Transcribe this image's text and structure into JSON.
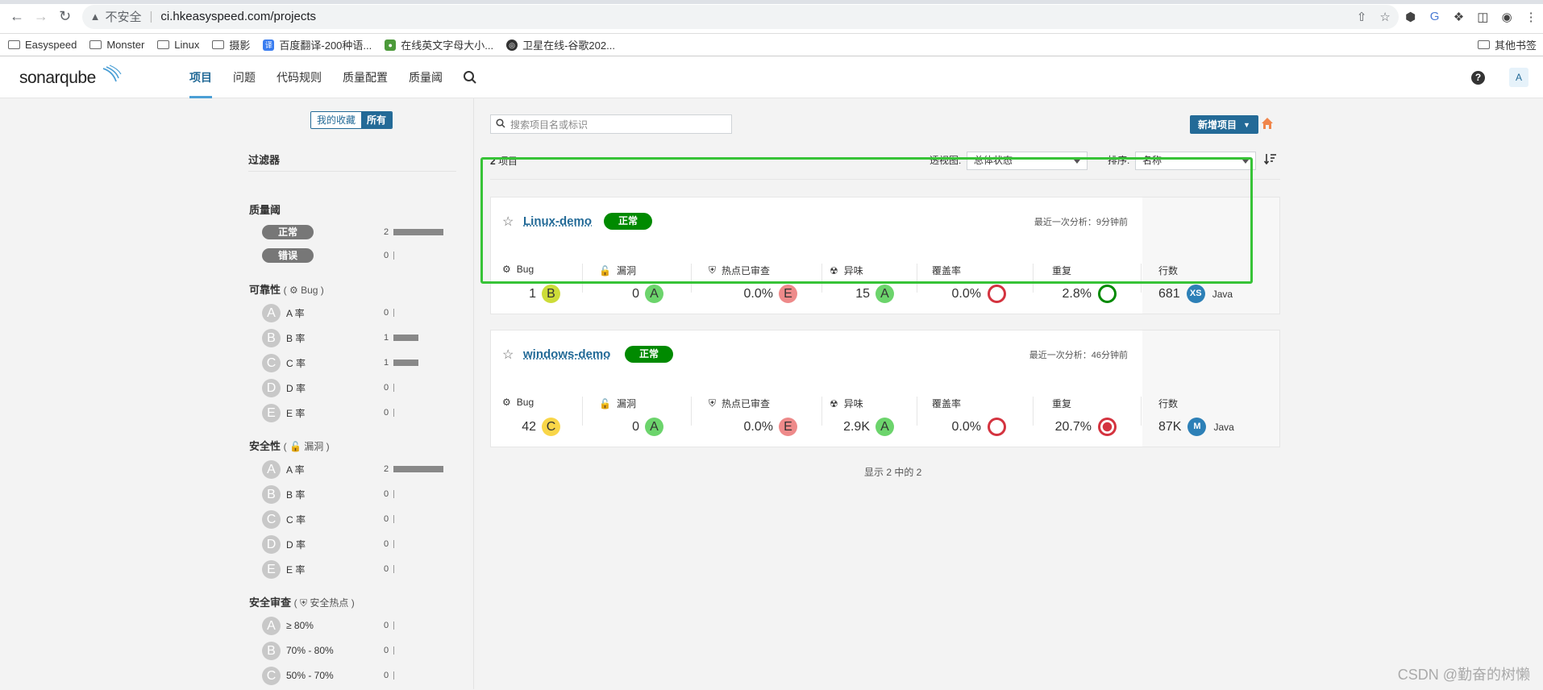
{
  "browser": {
    "insecure_label": "不安全",
    "url": "ci.hkeasyspeed.com/projects",
    "bookmarks": [
      {
        "label": "Easyspeed"
      },
      {
        "label": "Monster"
      },
      {
        "label": "Linux"
      },
      {
        "label": "摄影"
      },
      {
        "label": "百度翻译-200种语..."
      },
      {
        "label": "在线英文字母大小..."
      },
      {
        "label": "卫星在线-谷歌202..."
      }
    ],
    "other_bookmarks": "其他书签"
  },
  "header": {
    "logo": "sonarqube",
    "nav": [
      "项目",
      "问题",
      "代码规则",
      "质量配置",
      "质量阈"
    ],
    "avatar": "A",
    "help": "?"
  },
  "sidebar": {
    "toggle": {
      "favorites": "我的收藏",
      "all": "所有"
    },
    "filter_title": "过滤器",
    "quality_gate": {
      "title": "质量阈",
      "rows": [
        {
          "label": "正常",
          "count": "2",
          "ratio": 1.0
        },
        {
          "label": "错误",
          "count": "0",
          "ratio": 0
        }
      ]
    },
    "reliability": {
      "title": "可靠性",
      "sub": "Bug",
      "rows": [
        {
          "letter": "A",
          "label": "A 率",
          "count": "0",
          "ratio": 0
        },
        {
          "letter": "B",
          "label": "B 率",
          "count": "1",
          "ratio": 0.5
        },
        {
          "letter": "C",
          "label": "C 率",
          "count": "1",
          "ratio": 0.5
        },
        {
          "letter": "D",
          "label": "D 率",
          "count": "0",
          "ratio": 0
        },
        {
          "letter": "E",
          "label": "E 率",
          "count": "0",
          "ratio": 0
        }
      ]
    },
    "security": {
      "title": "安全性",
      "sub": "漏洞",
      "rows": [
        {
          "letter": "A",
          "label": "A 率",
          "count": "2",
          "ratio": 1.0
        },
        {
          "letter": "B",
          "label": "B 率",
          "count": "0",
          "ratio": 0
        },
        {
          "letter": "C",
          "label": "C 率",
          "count": "0",
          "ratio": 0
        },
        {
          "letter": "D",
          "label": "D 率",
          "count": "0",
          "ratio": 0
        },
        {
          "letter": "E",
          "label": "E 率",
          "count": "0",
          "ratio": 0
        }
      ]
    },
    "hotspots": {
      "title": "安全审查",
      "sub": "安全热点",
      "rows": [
        {
          "letter": "A",
          "label": "≥ 80%",
          "count": "0",
          "ratio": 0
        },
        {
          "letter": "B",
          "label": "70% - 80%",
          "count": "0",
          "ratio": 0
        },
        {
          "letter": "C",
          "label": "50% - 70%",
          "count": "0",
          "ratio": 0
        }
      ]
    }
  },
  "toolbar": {
    "search_placeholder": "搜索项目名或标识",
    "new_project": "新增项目",
    "count_num": "2",
    "count_unit": "项目",
    "view_label": "透视图:",
    "view_value": "总体状态",
    "sort_label": "排序:",
    "sort_value": "名称"
  },
  "metric_labels": {
    "bugs": "Bug",
    "vulns": "漏洞",
    "hotspots": "热点已审查",
    "smells": "异味",
    "coverage": "覆盖率",
    "dup": "重复",
    "lines": "行数"
  },
  "projects": [
    {
      "name": "Linux-demo",
      "status": "正常",
      "last_analysis": "最近一次分析：9分钟前",
      "bugs": "1",
      "bugs_grade": "B",
      "vulns": "0",
      "vulns_grade": "A",
      "hotspots": "0.0%",
      "hotspots_grade": "E",
      "smells": "15",
      "smells_grade": "A",
      "coverage": "0.0%",
      "dup": "2.8%",
      "lines": "681",
      "size": "XS",
      "lang": "Java"
    },
    {
      "name": "windows-demo",
      "status": "正常",
      "last_analysis": "最近一次分析：46分钟前",
      "bugs": "42",
      "bugs_grade": "C",
      "vulns": "0",
      "vulns_grade": "A",
      "hotspots": "0.0%",
      "hotspots_grade": "E",
      "smells": "2.9K",
      "smells_grade": "A",
      "coverage": "0.0%",
      "dup": "20.7%",
      "lines": "87K",
      "size": "M",
      "lang": "Java"
    }
  ],
  "footer": "显示 2 中的 2",
  "watermark": "CSDN @勤奋的树懒",
  "colors": {
    "grade_A": "#6cd46c",
    "grade_B": "#cddc39",
    "grade_C": "#f9d648",
    "grade_E": "#ee8a8a",
    "ring_red": "#d4333f",
    "ring_green": "#008a00",
    "status_ok": "#008a00",
    "accent": "#236a97"
  }
}
